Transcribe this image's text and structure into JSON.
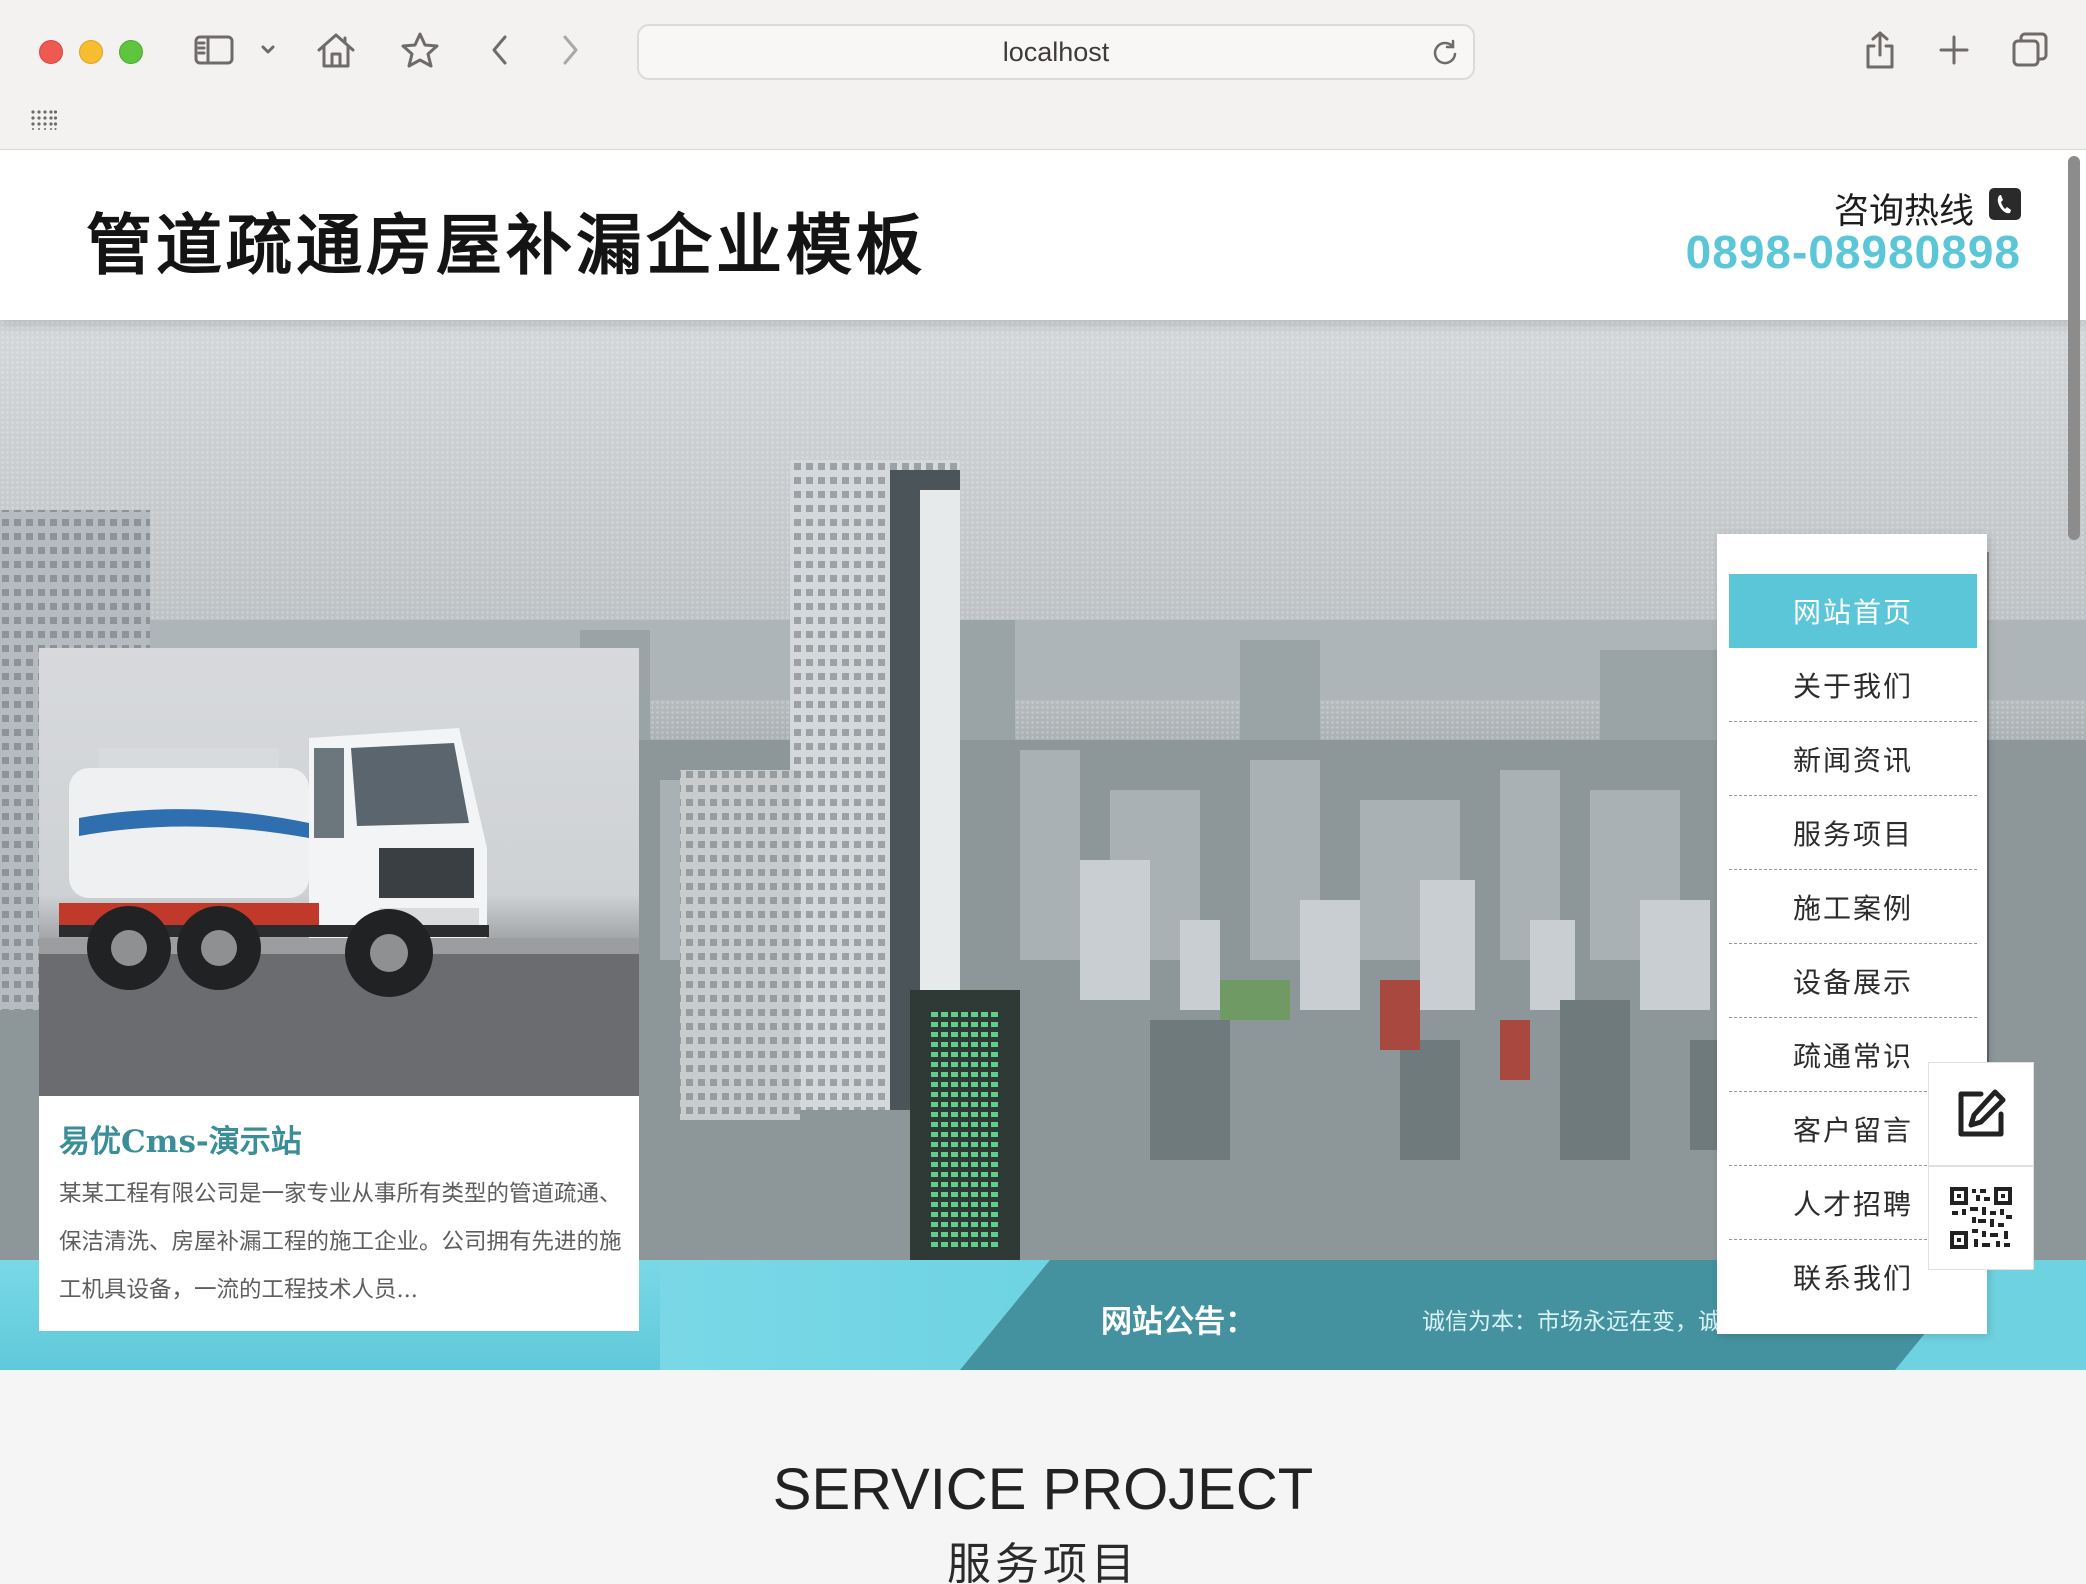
{
  "browser": {
    "url": "localhost",
    "icons": [
      "sidebar-icon",
      "chevron-down-icon",
      "home-icon",
      "star-icon",
      "back-icon",
      "forward-icon",
      "reload-icon",
      "share-icon",
      "new-tab-icon",
      "tabs-overview-icon",
      "apps-grid-icon"
    ]
  },
  "header": {
    "site_title": "管道疏通房屋补漏企业模板",
    "hotline_label": "咨询热线",
    "hotline_number": "0898-08980898"
  },
  "nav": {
    "items": [
      {
        "label": "网站首页",
        "active": true
      },
      {
        "label": "关于我们",
        "active": false
      },
      {
        "label": "新闻资讯",
        "active": false
      },
      {
        "label": "服务项目",
        "active": false
      },
      {
        "label": "施工案例",
        "active": false
      },
      {
        "label": "设备展示",
        "active": false
      },
      {
        "label": "疏通常识",
        "active": false
      },
      {
        "label": "客户留言",
        "active": false
      },
      {
        "label": "人才招聘",
        "active": false
      },
      {
        "label": "联系我们",
        "active": false
      }
    ]
  },
  "intro": {
    "title": "易优Cms-演示站",
    "text": "某某工程有限公司是一家专业从事所有类型的管道疏通、保洁清洗、房屋补漏工程的施工企业。公司拥有先进的施工机具设备，一流的工程技术人员..."
  },
  "notice": {
    "label": "网站公告：",
    "text": "诚信为本：市场永远在变，诚信永远不变。"
  },
  "section": {
    "title_en": "SERVICE PROJECT",
    "title_cn": "服务项目"
  },
  "colors": {
    "accent": "#5bc6d8",
    "notice_dark": "#44929f",
    "intro_title": "#3a8e98"
  }
}
